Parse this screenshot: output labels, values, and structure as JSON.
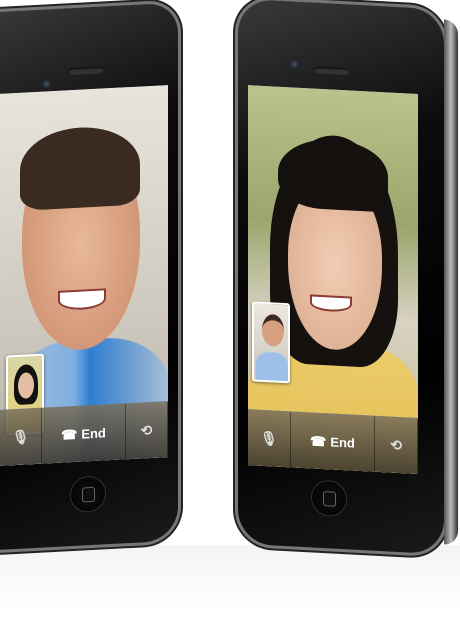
{
  "phones": [
    {
      "name": "left-phone",
      "call_bar": {
        "mute_icon": "microphone-mute-icon",
        "end_icon": "phone-handset-icon",
        "end_label": "End",
        "switch_icon": "camera-switch-icon"
      }
    },
    {
      "name": "right-phone",
      "call_bar": {
        "mute_icon": "microphone-mute-icon",
        "end_icon": "phone-handset-icon",
        "end_label": "End",
        "switch_icon": "camera-switch-icon"
      }
    }
  ],
  "colors": {
    "end_text": "#ffffff",
    "body": "#000000",
    "bezel": "#777777"
  }
}
